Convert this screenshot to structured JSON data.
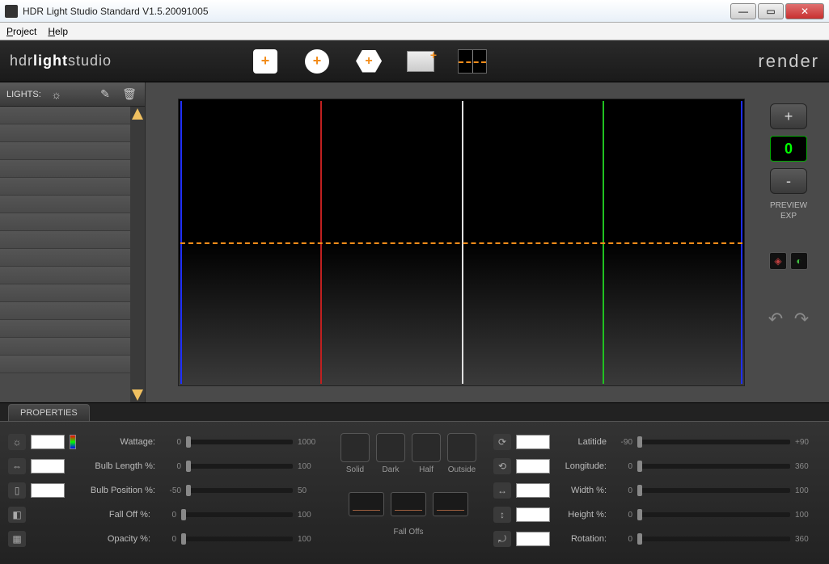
{
  "window": {
    "title": "HDR Light Studio   Standard V1.5.20091005"
  },
  "menu": {
    "project": "Project",
    "help": "Help"
  },
  "branding": {
    "prefix": "hdr",
    "bold": "light",
    "suffix": "studio"
  },
  "toolbar": {
    "render": "render"
  },
  "lights": {
    "header_label": "LIGHTS:"
  },
  "preview": {
    "plus": "+",
    "value": "0",
    "minus": "-",
    "label_line1": "PREVIEW",
    "label_line2": "EXP"
  },
  "properties": {
    "tab": "PROPERTIES",
    "left": [
      {
        "label": "Wattage:",
        "min": "0",
        "max": "1000"
      },
      {
        "label": "Bulb Length %:",
        "min": "0",
        "max": "100"
      },
      {
        "label": "Bulb Position %:",
        "min": "-50",
        "max": "50"
      },
      {
        "label": "Fall Off %:",
        "min": "0",
        "max": "100"
      },
      {
        "label": "Opacity %:",
        "min": "0",
        "max": "100"
      }
    ],
    "shades": [
      "Solid",
      "Dark",
      "Half",
      "Outside"
    ],
    "falloffs_label": "Fall Offs",
    "right": [
      {
        "label": "Latitide",
        "min": "-90",
        "max": "+90"
      },
      {
        "label": "Longitude:",
        "min": "0",
        "max": "360"
      },
      {
        "label": "Width %:",
        "min": "0",
        "max": "100"
      },
      {
        "label": "Height %:",
        "min": "0",
        "max": "100"
      },
      {
        "label": "Rotation:",
        "min": "0",
        "max": "360"
      }
    ]
  }
}
